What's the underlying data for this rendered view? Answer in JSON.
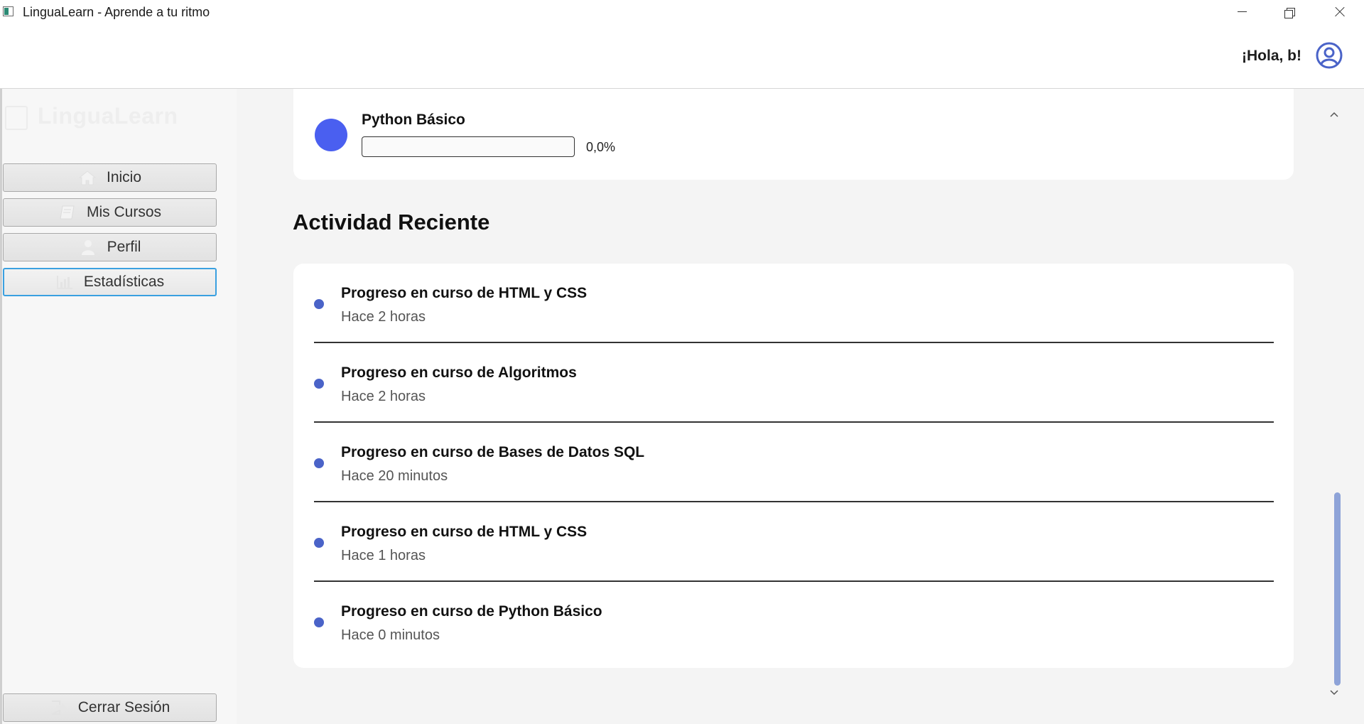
{
  "window": {
    "title": "LinguaLearn - Aprende a tu ritmo"
  },
  "header": {
    "greeting": "¡Hola, b!"
  },
  "sidebar": {
    "logo": "LinguaLearn",
    "items": [
      {
        "label": "Inicio",
        "icon": "home-icon"
      },
      {
        "label": "Mis Cursos",
        "icon": "book-icon"
      },
      {
        "label": "Perfil",
        "icon": "user-icon"
      },
      {
        "label": "Estadísticas",
        "icon": "chart-icon",
        "active": true
      }
    ],
    "logout_label": "Cerrar Sesión"
  },
  "course": {
    "name": "Python Básico",
    "progress_text": "0,0%",
    "progress_fraction": 0.0
  },
  "activity": {
    "title": "Actividad Reciente",
    "items": [
      {
        "title": "Progreso en curso de HTML y CSS",
        "time": "Hace 2 horas"
      },
      {
        "title": "Progreso en curso de Algoritmos",
        "time": "Hace 2 horas"
      },
      {
        "title": "Progreso en curso de Bases de Datos SQL",
        "time": "Hace 20 minutos"
      },
      {
        "title": "Progreso en curso de HTML y CSS",
        "time": "Hace 1 horas"
      },
      {
        "title": "Progreso en curso de Python Básico",
        "time": "Hace 0 minutos"
      }
    ]
  },
  "colors": {
    "accent": "#4a5ff0",
    "activity_dot": "#4a63c8",
    "active_border": "#3aa0e0",
    "scroll_thumb": "#8ea3d8"
  }
}
